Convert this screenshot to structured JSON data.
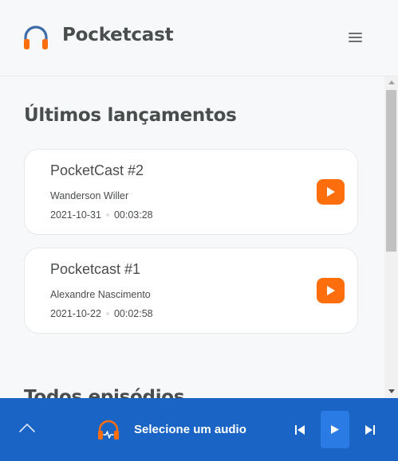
{
  "header": {
    "brand": "Pocketcast",
    "logo_icon": "headphones-icon",
    "menu_icon": "hamburger-menu-icon"
  },
  "latest": {
    "title": "Últimos lançamentos",
    "episodes": [
      {
        "title": "PocketCast #2",
        "author": "Wanderson Willer",
        "date": "2021-10-31",
        "duration": "00:03:28"
      },
      {
        "title": "Pocketcast #1",
        "author": "Alexandre Nascimento",
        "date": "2021-10-22",
        "duration": "00:02:58"
      }
    ]
  },
  "all": {
    "title": "Todos episódios"
  },
  "player": {
    "status": "Selecione um audio",
    "expand_icon": "chevron-up-icon",
    "prev_icon": "skip-previous-icon",
    "play_icon": "play-icon",
    "next_icon": "skip-next-icon"
  },
  "colors": {
    "accent": "#ff6e0d",
    "player_bg": "#1a64c5",
    "text": "#494d4b",
    "headphone_blue": "#3e6ca8"
  }
}
